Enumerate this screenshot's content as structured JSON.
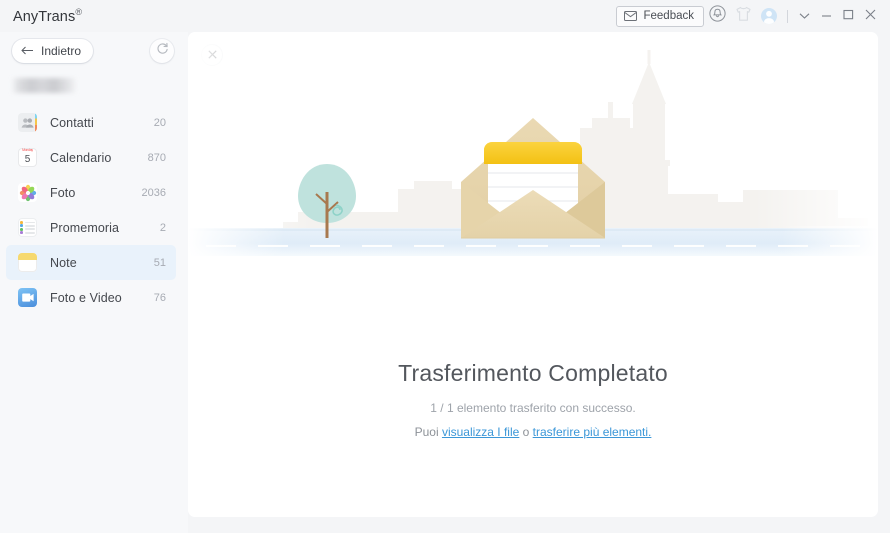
{
  "window": {
    "title": "AnyTrans",
    "registered_mark": "®",
    "feedback_label": "Feedback",
    "icons": {
      "feedback": "envelope-icon",
      "notification": "bell-icon",
      "shirt": "t-shirt-icon",
      "account": "user-avatar-icon",
      "more": "chevron-down-icon",
      "minimize": "minimize-icon",
      "maximize": "maximize-icon",
      "close": "close-icon"
    }
  },
  "sidebar": {
    "back_label": "Indietro",
    "back_icon": "arrow-left-icon",
    "refresh_icon": "refresh-icon",
    "device_name": "",
    "items": [
      {
        "label": "Contatti",
        "count": "20",
        "icon": "contacts-icon",
        "selected": false
      },
      {
        "label": "Calendario",
        "count": "870",
        "icon": "calendar-icon",
        "selected": false
      },
      {
        "label": "Foto",
        "count": "2036",
        "icon": "photos-icon",
        "selected": false
      },
      {
        "label": "Promemoria",
        "count": "2",
        "icon": "reminders-icon",
        "selected": false
      },
      {
        "label": "Note",
        "count": "51",
        "icon": "notes-icon",
        "selected": true
      },
      {
        "label": "Foto e Video",
        "count": "76",
        "icon": "photos-videos-icon",
        "selected": false
      }
    ]
  },
  "content": {
    "close_icon": "close-icon",
    "illustration": "envelope-city-illustration",
    "title": "Trasferimento Completato",
    "subtitle": "1 / 1 elemento trasferito con successo.",
    "links_prefix": "Puoi ",
    "link_view": "visualizza I file",
    "links_middle": " o ",
    "link_transfer": "trasferire più elementi.",
    "link_suffix": ""
  },
  "colors": {
    "accent_link": "#3b97d8",
    "selection": "#e9f2fb",
    "sidebar_bg": "#f7f8fa",
    "page_bg": "#f4f5f7",
    "envelope": "#e7d6ab",
    "note_header": "#f5c518"
  }
}
